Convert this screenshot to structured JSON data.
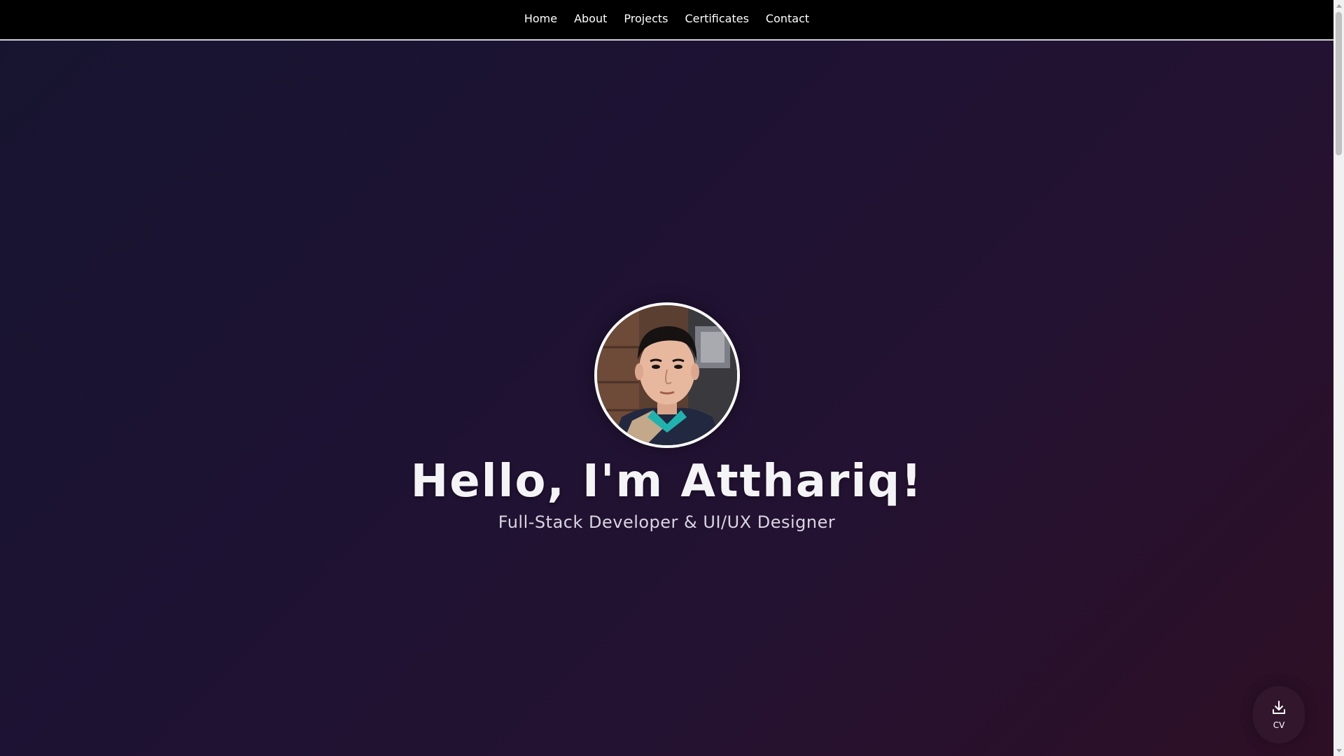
{
  "nav": {
    "items": [
      {
        "label": "Home"
      },
      {
        "label": "About"
      },
      {
        "label": "Projects"
      },
      {
        "label": "Certificates"
      },
      {
        "label": "Contact"
      }
    ]
  },
  "hero": {
    "avatar_icon": "profile-photo",
    "title": "Hello, I'm Atthariq!",
    "subtitle": "Full-Stack Developer & UI/UX Designer"
  },
  "cv_button": {
    "icon": "download-icon",
    "label": "CV"
  },
  "colors": {
    "nav_background": "#000000",
    "page_gradient_start": "#161530",
    "page_gradient_end": "#2d0f24",
    "text": "#ffffff"
  }
}
